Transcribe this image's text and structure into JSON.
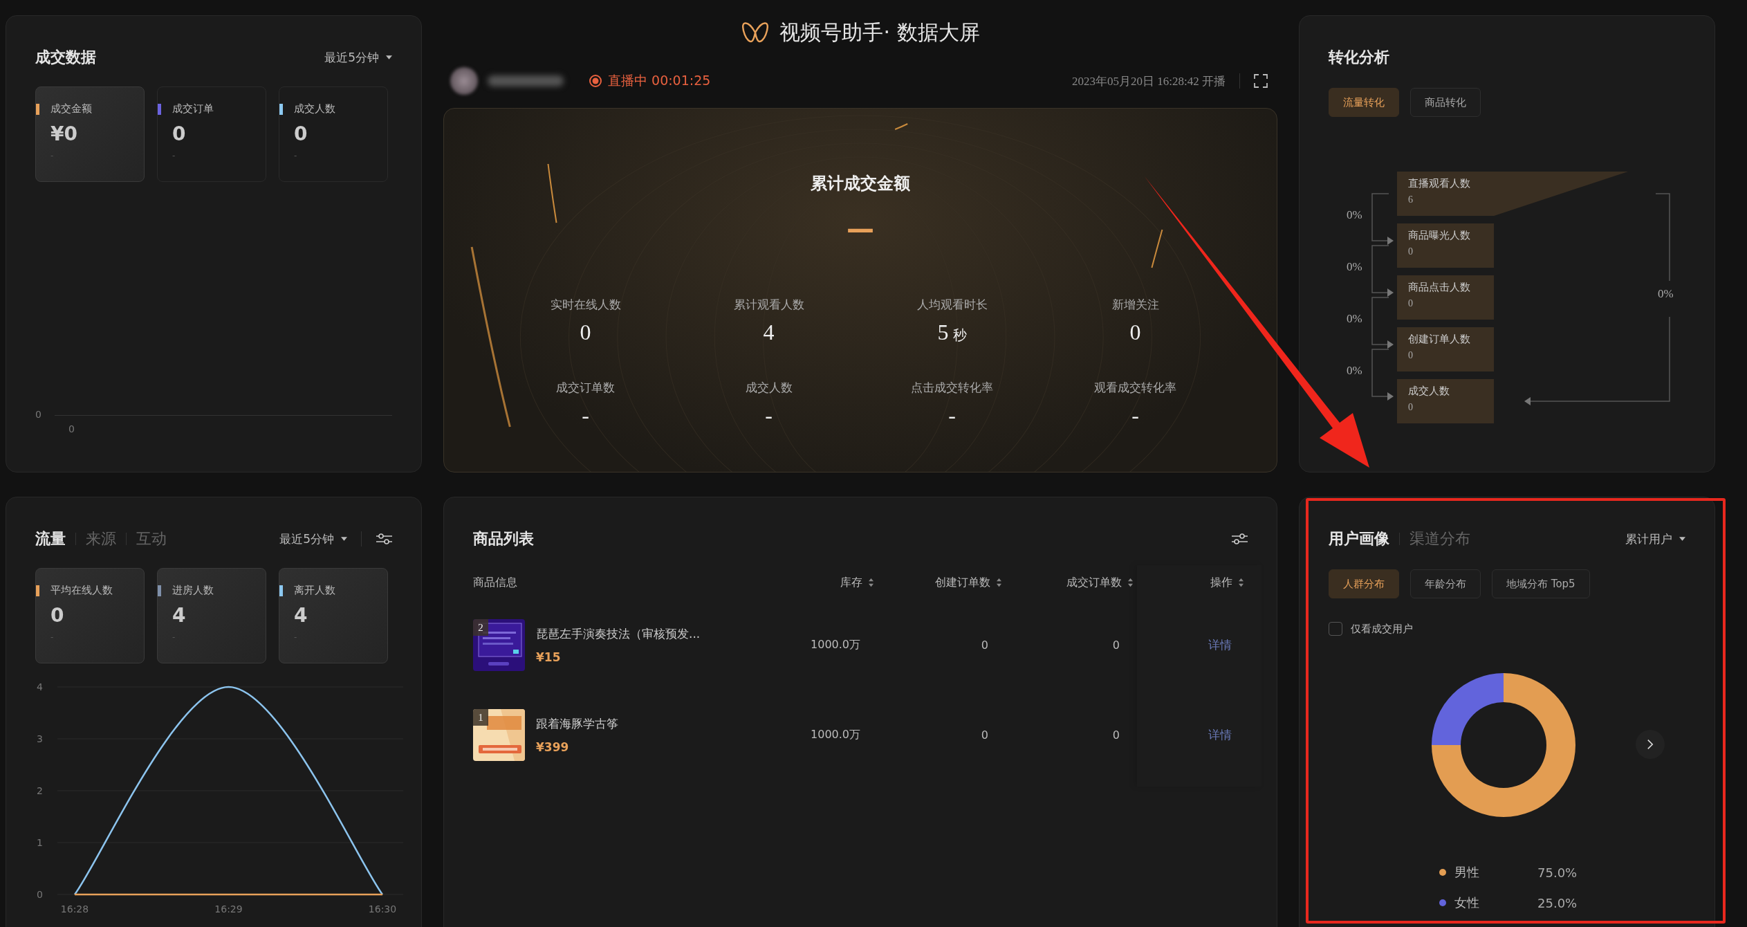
{
  "header": {
    "title": "视频号助手· 数据大屏",
    "live_status": "直播中 00:01:25",
    "start_time": "2023年05月20日 16:28:42 开播"
  },
  "deal_panel": {
    "title": "成交数据",
    "range": "最近5分钟",
    "cards": [
      {
        "label": "成交金额",
        "value": "¥0",
        "sub": "-",
        "color": "#e8a15a",
        "selected": true
      },
      {
        "label": "成交订单",
        "value": "0",
        "sub": "-",
        "color": "#6b63e0",
        "selected": false
      },
      {
        "label": "成交人数",
        "value": "0",
        "sub": "-",
        "color": "#8cc8f0",
        "selected": false
      }
    ],
    "chart_axis": {
      "y_tick": "0",
      "x_tick": "0"
    }
  },
  "summary": {
    "title": "累计成交金额",
    "value": "—",
    "metrics": [
      {
        "label": "实时在线人数",
        "value": "0"
      },
      {
        "label": "累计观看人数",
        "value": "4"
      },
      {
        "label": "人均观看时长",
        "value": "5",
        "unit": "秒"
      },
      {
        "label": "新增关注",
        "value": "0"
      },
      {
        "label": "成交订单数",
        "value": "-"
      },
      {
        "label": "成交人数",
        "value": "-"
      },
      {
        "label": "点击成交转化率",
        "value": "-"
      },
      {
        "label": "观看成交转化率",
        "value": "-"
      }
    ]
  },
  "conversion": {
    "title": "转化分析",
    "tabs": [
      {
        "label": "流量转化",
        "selected": true
      },
      {
        "label": "商品转化",
        "selected": false
      }
    ],
    "steps": [
      {
        "label": "直播观看人数",
        "value": "6"
      },
      {
        "label": "商品曝光人数",
        "value": "0"
      },
      {
        "label": "商品点击人数",
        "value": "0"
      },
      {
        "label": "创建订单人数",
        "value": "0"
      },
      {
        "label": "成交人数",
        "value": "0"
      }
    ],
    "step_rates": [
      "0%",
      "0%",
      "0%",
      "0%"
    ],
    "overall_rate": "0%"
  },
  "traffic": {
    "tabs": [
      {
        "label": "流量",
        "selected": true
      },
      {
        "label": "来源",
        "selected": false
      },
      {
        "label": "互动",
        "selected": false
      }
    ],
    "range": "最近5分钟",
    "cards": [
      {
        "label": "平均在线人数",
        "value": "0",
        "sub": "-",
        "color": "#e8a15a",
        "selected": true
      },
      {
        "label": "进房人数",
        "value": "4",
        "sub": "-",
        "color": "#7f90aa",
        "selected": true
      },
      {
        "label": "离开人数",
        "value": "4",
        "sub": "-",
        "color": "#8cc8f0",
        "selected": true
      }
    ],
    "chart_data": {
      "type": "line",
      "categories": [
        "16:28",
        "16:29",
        "16:30"
      ],
      "ylim": [
        0,
        4
      ],
      "yticks": [
        0,
        1,
        2,
        3,
        4
      ],
      "grid": true,
      "series": [
        {
          "color": "#8cc4ee",
          "values": [
            0,
            4,
            0
          ]
        },
        {
          "color": "#e8a15a",
          "values": [
            0,
            0,
            0
          ]
        }
      ]
    }
  },
  "products": {
    "title": "商品列表",
    "columns": [
      {
        "label": "商品信息",
        "sortable": false
      },
      {
        "label": "库存",
        "sortable": true
      },
      {
        "label": "创建订单数",
        "sortable": true
      },
      {
        "label": "成交订单数",
        "sortable": true
      },
      {
        "label": "操作",
        "sortable": true
      }
    ],
    "rows": [
      {
        "rank": "2",
        "name": "琵琶左手演奏技法（审核预发...",
        "price": "¥15",
        "stock": "1000.0万",
        "created_orders": "0",
        "deal_orders": "0",
        "action": "详情"
      },
      {
        "rank": "1",
        "name": "跟着海豚学古筝",
        "price": "¥399",
        "stock": "1000.0万",
        "created_orders": "0",
        "deal_orders": "0",
        "action": "详情"
      }
    ]
  },
  "portrait": {
    "tabs": [
      {
        "label": "用户画像",
        "selected": true
      },
      {
        "label": "渠道分布",
        "selected": false
      }
    ],
    "range": "累计用户",
    "chips": [
      {
        "label": "人群分布",
        "selected": true
      },
      {
        "label": "年龄分布",
        "selected": false
      },
      {
        "label": "地域分布 Top5",
        "selected": false
      }
    ],
    "checkbox": {
      "label": "仅看成交用户",
      "checked": false
    },
    "chart_data": {
      "type": "donut",
      "values": [
        75,
        25
      ]
    },
    "legend": [
      {
        "label": "男性",
        "value": "75.0%",
        "color": "#e39d52"
      },
      {
        "label": "女性",
        "value": "25.0%",
        "color": "#6264dc"
      }
    ]
  },
  "annotations": [
    {
      "kind": "arrow"
    },
    {
      "kind": "frame"
    }
  ]
}
